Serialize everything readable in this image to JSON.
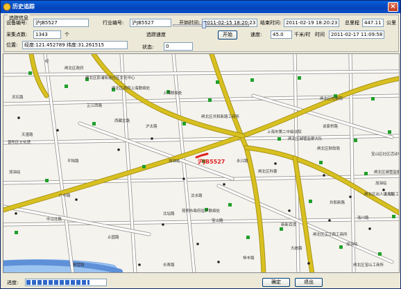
{
  "window": {
    "title": "历史追踪",
    "close": "×"
  },
  "panel": {
    "group_title": "追踪信息",
    "device_label": "设备编号:",
    "device_value": "沪JB5527",
    "industry_label": "行业编号:",
    "industry_value": "沪JB5527",
    "start_label": "开始时间:",
    "start_value": "2011-02-15 18:20:23",
    "end_label": "结束时间:",
    "end_value": "2011-02-19 18:20:23",
    "mileage_label": "总里程",
    "mileage_value": "447.11",
    "mileage_unit": "公里",
    "points_label": "采集点数:",
    "points_value": "1343",
    "points_unit": "个",
    "speed_label": "追踪速度",
    "start_button": "开始",
    "speed2_label": "速度:",
    "speed2_value": "45.0",
    "speed2_unit": "千米/时",
    "time_label": "时间",
    "time_value": "2011-02-17 11:09:58",
    "position_label": "位置:",
    "position_value": "经度:121.452789 纬度:31.261515",
    "status_label": "状态:",
    "status_value": "0"
  },
  "map": {
    "vehicle_label": "沪JB5527",
    "places": [
      "纪",
      "闸北区政府",
      "闸北区彭浦街道社区文化中心",
      "闸北区政府上海联络处",
      "上海联络处",
      "闸北区共和新路工商所",
      "上海市第二中级法院",
      "闸北区城管监察大队",
      "闸北区检察院",
      "闸北区财政局",
      "加油站",
      "闸北区科委",
      "宝山区社区活动中心",
      "闸北区城管监察大队",
      "普陀区文化馆",
      "加油站",
      "昆明市政府驻沪联络处",
      "新新百货",
      "闸北区芷江西工商所",
      "加油站",
      "加油站",
      "上海轻工工商所",
      "闸北区出人境大队",
      "闸北区宝山工商所",
      "止园路",
      "汶水路",
      "共和新路",
      "广中路",
      "永兴路",
      "中山北路",
      "天潼路",
      "芷江西路",
      "沪太路",
      "宝山路",
      "大统路",
      "恒丰路",
      "柳营路",
      "长寿路",
      "谈家桥路",
      "灵石路",
      "西藏北路",
      "平陆路",
      "洛川路",
      "北站路"
    ],
    "colors": {
      "highway": "#D8C020",
      "highway_edge": "#A89418",
      "road": "#FFFFFF",
      "road_edge": "#8E8A84",
      "marker_green": "#1FA02A",
      "route_red": "#E02020"
    }
  },
  "bottom": {
    "progress_label": "进度:",
    "progress_percent": 80,
    "ok_button": "确定",
    "exit_button": "退出"
  }
}
